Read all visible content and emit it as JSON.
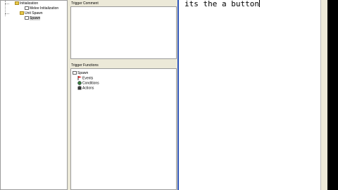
{
  "tree": {
    "items": [
      {
        "label": "Initialization",
        "icon": "folder-icon"
      },
      {
        "label": "Melee Initialization",
        "icon": "trigger-icon"
      },
      {
        "label": "Unit Spawn",
        "icon": "folder-icon"
      },
      {
        "label": "Spawn",
        "icon": "trigger-icon"
      }
    ]
  },
  "trigger_comment": {
    "label": "Trigger Comment"
  },
  "trigger_functions": {
    "label": "Trigger Functions",
    "root": "Spawn",
    "items": [
      {
        "label": "Events",
        "icon": "red-flag-icon"
      },
      {
        "label": "Conditions",
        "icon": "conditions-icon"
      },
      {
        "label": "Actions",
        "icon": "actions-icon"
      }
    ]
  },
  "editor": {
    "text": "its the a button"
  },
  "colors": {
    "panel": "#ece9d8",
    "accent_border": "#2f55b8",
    "folder": "#e9c94a"
  }
}
